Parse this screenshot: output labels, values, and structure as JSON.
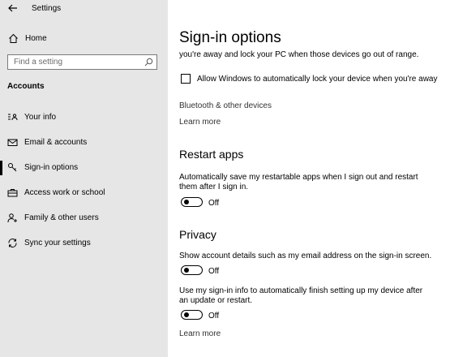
{
  "window": {
    "title": "Settings"
  },
  "sidebar": {
    "home_label": "Home",
    "search_placeholder": "Find a setting",
    "section_title": "Accounts",
    "items": [
      {
        "label": "Your info",
        "icon": "contact-card-icon"
      },
      {
        "label": "Email & accounts",
        "icon": "mail-icon"
      },
      {
        "label": "Sign-in options",
        "icon": "key-icon",
        "selected": true
      },
      {
        "label": "Access work or school",
        "icon": "briefcase-icon"
      },
      {
        "label": "Family & other users",
        "icon": "person-add-icon"
      },
      {
        "label": "Sync your settings",
        "icon": "sync-icon"
      }
    ]
  },
  "main": {
    "title": "Sign-in options",
    "dynamic_lock_text": "you're away and lock your PC when those devices go out of range.",
    "dynamic_lock_checkbox": {
      "label": "Allow Windows to automatically lock your device when you're away",
      "checked": false
    },
    "bluetooth_link": "Bluetooth & other devices",
    "learn_more_1": "Learn more",
    "restart_apps": {
      "heading": "Restart apps",
      "description_line1": "Automatically save my restartable apps when I sign out and restart",
      "description_line2": "them after I sign in.",
      "toggle_state": "Off"
    },
    "privacy": {
      "heading": "Privacy",
      "account_details_text": "Show account details such as my email address on the sign-in screen.",
      "account_details_state": "Off",
      "signin_info_line1": "Use my sign-in info to automatically finish setting up my device after",
      "signin_info_line2": "an update or restart.",
      "signin_info_state": "Off",
      "learn_more": "Learn more"
    }
  },
  "colors": {
    "sidebar_bg": "#e6e6e6",
    "highlight": "#f6b6bb"
  }
}
